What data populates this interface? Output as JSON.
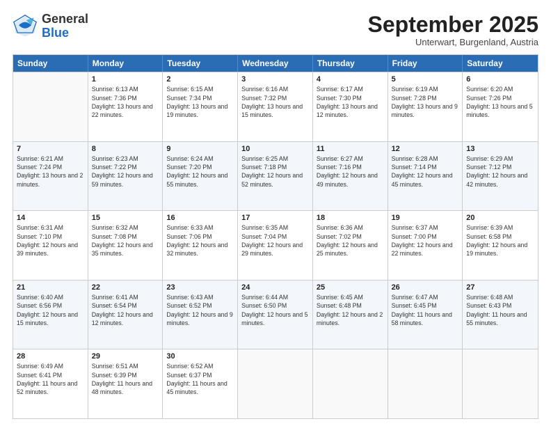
{
  "logo": {
    "general": "General",
    "blue": "Blue"
  },
  "title": "September 2025",
  "subtitle": "Unterwart, Burgenland, Austria",
  "header_days": [
    "Sunday",
    "Monday",
    "Tuesday",
    "Wednesday",
    "Thursday",
    "Friday",
    "Saturday"
  ],
  "weeks": [
    [
      {
        "day": "",
        "sunrise": "",
        "sunset": "",
        "daylight": ""
      },
      {
        "day": "1",
        "sunrise": "Sunrise: 6:13 AM",
        "sunset": "Sunset: 7:36 PM",
        "daylight": "Daylight: 13 hours and 22 minutes."
      },
      {
        "day": "2",
        "sunrise": "Sunrise: 6:15 AM",
        "sunset": "Sunset: 7:34 PM",
        "daylight": "Daylight: 13 hours and 19 minutes."
      },
      {
        "day": "3",
        "sunrise": "Sunrise: 6:16 AM",
        "sunset": "Sunset: 7:32 PM",
        "daylight": "Daylight: 13 hours and 15 minutes."
      },
      {
        "day": "4",
        "sunrise": "Sunrise: 6:17 AM",
        "sunset": "Sunset: 7:30 PM",
        "daylight": "Daylight: 13 hours and 12 minutes."
      },
      {
        "day": "5",
        "sunrise": "Sunrise: 6:19 AM",
        "sunset": "Sunset: 7:28 PM",
        "daylight": "Daylight: 13 hours and 9 minutes."
      },
      {
        "day": "6",
        "sunrise": "Sunrise: 6:20 AM",
        "sunset": "Sunset: 7:26 PM",
        "daylight": "Daylight: 13 hours and 5 minutes."
      }
    ],
    [
      {
        "day": "7",
        "sunrise": "Sunrise: 6:21 AM",
        "sunset": "Sunset: 7:24 PM",
        "daylight": "Daylight: 13 hours and 2 minutes."
      },
      {
        "day": "8",
        "sunrise": "Sunrise: 6:23 AM",
        "sunset": "Sunset: 7:22 PM",
        "daylight": "Daylight: 12 hours and 59 minutes."
      },
      {
        "day": "9",
        "sunrise": "Sunrise: 6:24 AM",
        "sunset": "Sunset: 7:20 PM",
        "daylight": "Daylight: 12 hours and 55 minutes."
      },
      {
        "day": "10",
        "sunrise": "Sunrise: 6:25 AM",
        "sunset": "Sunset: 7:18 PM",
        "daylight": "Daylight: 12 hours and 52 minutes."
      },
      {
        "day": "11",
        "sunrise": "Sunrise: 6:27 AM",
        "sunset": "Sunset: 7:16 PM",
        "daylight": "Daylight: 12 hours and 49 minutes."
      },
      {
        "day": "12",
        "sunrise": "Sunrise: 6:28 AM",
        "sunset": "Sunset: 7:14 PM",
        "daylight": "Daylight: 12 hours and 45 minutes."
      },
      {
        "day": "13",
        "sunrise": "Sunrise: 6:29 AM",
        "sunset": "Sunset: 7:12 PM",
        "daylight": "Daylight: 12 hours and 42 minutes."
      }
    ],
    [
      {
        "day": "14",
        "sunrise": "Sunrise: 6:31 AM",
        "sunset": "Sunset: 7:10 PM",
        "daylight": "Daylight: 12 hours and 39 minutes."
      },
      {
        "day": "15",
        "sunrise": "Sunrise: 6:32 AM",
        "sunset": "Sunset: 7:08 PM",
        "daylight": "Daylight: 12 hours and 35 minutes."
      },
      {
        "day": "16",
        "sunrise": "Sunrise: 6:33 AM",
        "sunset": "Sunset: 7:06 PM",
        "daylight": "Daylight: 12 hours and 32 minutes."
      },
      {
        "day": "17",
        "sunrise": "Sunrise: 6:35 AM",
        "sunset": "Sunset: 7:04 PM",
        "daylight": "Daylight: 12 hours and 29 minutes."
      },
      {
        "day": "18",
        "sunrise": "Sunrise: 6:36 AM",
        "sunset": "Sunset: 7:02 PM",
        "daylight": "Daylight: 12 hours and 25 minutes."
      },
      {
        "day": "19",
        "sunrise": "Sunrise: 6:37 AM",
        "sunset": "Sunset: 7:00 PM",
        "daylight": "Daylight: 12 hours and 22 minutes."
      },
      {
        "day": "20",
        "sunrise": "Sunrise: 6:39 AM",
        "sunset": "Sunset: 6:58 PM",
        "daylight": "Daylight: 12 hours and 19 minutes."
      }
    ],
    [
      {
        "day": "21",
        "sunrise": "Sunrise: 6:40 AM",
        "sunset": "Sunset: 6:56 PM",
        "daylight": "Daylight: 12 hours and 15 minutes."
      },
      {
        "day": "22",
        "sunrise": "Sunrise: 6:41 AM",
        "sunset": "Sunset: 6:54 PM",
        "daylight": "Daylight: 12 hours and 12 minutes."
      },
      {
        "day": "23",
        "sunrise": "Sunrise: 6:43 AM",
        "sunset": "Sunset: 6:52 PM",
        "daylight": "Daylight: 12 hours and 9 minutes."
      },
      {
        "day": "24",
        "sunrise": "Sunrise: 6:44 AM",
        "sunset": "Sunset: 6:50 PM",
        "daylight": "Daylight: 12 hours and 5 minutes."
      },
      {
        "day": "25",
        "sunrise": "Sunrise: 6:45 AM",
        "sunset": "Sunset: 6:48 PM",
        "daylight": "Daylight: 12 hours and 2 minutes."
      },
      {
        "day": "26",
        "sunrise": "Sunrise: 6:47 AM",
        "sunset": "Sunset: 6:45 PM",
        "daylight": "Daylight: 11 hours and 58 minutes."
      },
      {
        "day": "27",
        "sunrise": "Sunrise: 6:48 AM",
        "sunset": "Sunset: 6:43 PM",
        "daylight": "Daylight: 11 hours and 55 minutes."
      }
    ],
    [
      {
        "day": "28",
        "sunrise": "Sunrise: 6:49 AM",
        "sunset": "Sunset: 6:41 PM",
        "daylight": "Daylight: 11 hours and 52 minutes."
      },
      {
        "day": "29",
        "sunrise": "Sunrise: 6:51 AM",
        "sunset": "Sunset: 6:39 PM",
        "daylight": "Daylight: 11 hours and 48 minutes."
      },
      {
        "day": "30",
        "sunrise": "Sunrise: 6:52 AM",
        "sunset": "Sunset: 6:37 PM",
        "daylight": "Daylight: 11 hours and 45 minutes."
      },
      {
        "day": "",
        "sunrise": "",
        "sunset": "",
        "daylight": ""
      },
      {
        "day": "",
        "sunrise": "",
        "sunset": "",
        "daylight": ""
      },
      {
        "day": "",
        "sunrise": "",
        "sunset": "",
        "daylight": ""
      },
      {
        "day": "",
        "sunrise": "",
        "sunset": "",
        "daylight": ""
      }
    ]
  ]
}
